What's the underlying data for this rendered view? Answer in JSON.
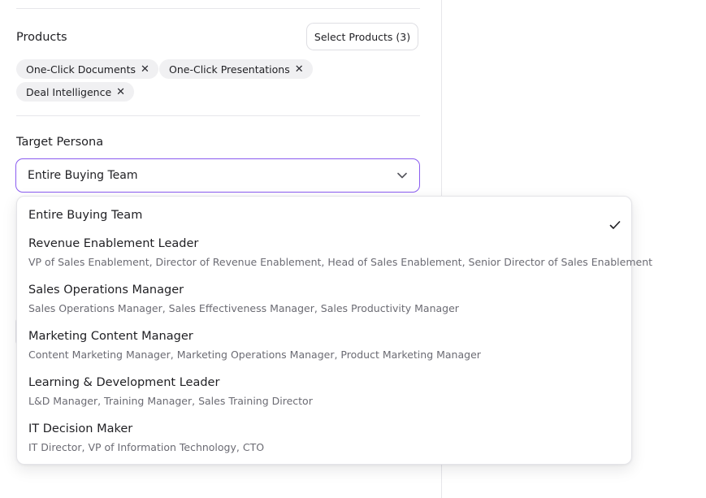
{
  "products": {
    "label": "Products",
    "select_button": "Select Products (3)",
    "chips": [
      {
        "label": "One-Click Documents",
        "remove": "✕"
      },
      {
        "label": "One-Click Presentations",
        "remove": "✕"
      },
      {
        "label": "Deal Intelligence",
        "remove": "✕"
      }
    ]
  },
  "persona": {
    "label": "Target Persona",
    "selected_value": "Entire Buying Team",
    "icons": {
      "toggle": "chevron-down-icon",
      "selected_marker": "checkmark-icon"
    },
    "options": [
      {
        "title": "Entire Buying Team",
        "subtitle": "",
        "selected": true
      },
      {
        "title": "Revenue Enablement Leader",
        "subtitle": "VP of Sales Enablement, Director of Revenue Enablement, Head of Sales Enablement, Senior Director of Sales Enablement",
        "selected": false
      },
      {
        "title": "Sales Operations Manager",
        "subtitle": "Sales Operations Manager, Sales Effectiveness Manager, Sales Productivity Manager",
        "selected": false
      },
      {
        "title": "Marketing Content Manager",
        "subtitle": "Content Marketing Manager, Marketing Operations Manager, Product Marketing Manager",
        "selected": false
      },
      {
        "title": "Learning & Development Leader",
        "subtitle": "L&D Manager, Training Manager, Sales Training Director",
        "selected": false
      },
      {
        "title": "IT Decision Maker",
        "subtitle": "IT Director, VP of Information Technology, CTO",
        "selected": false
      }
    ]
  },
  "colors": {
    "focus_border": "#8a5cf0",
    "chip_bg": "#f0f0f2",
    "divider": "#e6e6ea",
    "subtitle_text": "#6b6b73"
  }
}
